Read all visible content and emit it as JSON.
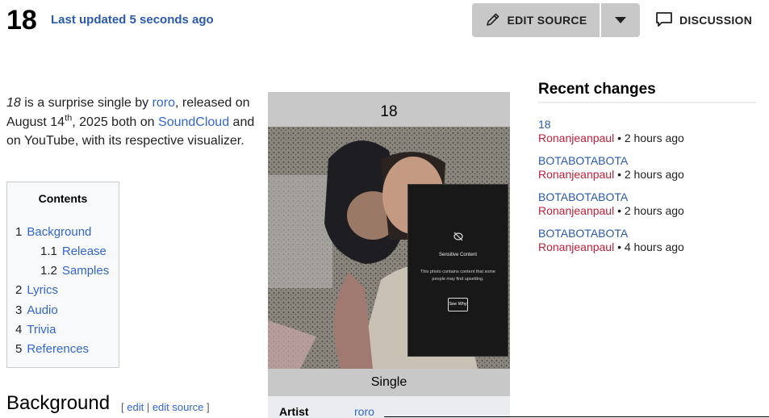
{
  "header": {
    "title": "18",
    "last_updated": "Last updated 5 seconds ago",
    "edit_source_label": "EDIT SOURCE",
    "discussion_label": "DISCUSSION"
  },
  "intro": {
    "title_italic": "18",
    "text1": " is a surprise single by ",
    "artist_link": "roro",
    "text2": ", released on August 14",
    "sup": "th",
    "text3": ", 2025 both on ",
    "soundcloud_link": "SoundCloud",
    "text4": " and on YouTube, with its respective visualizer."
  },
  "toc": {
    "title": "Contents",
    "items": [
      {
        "num": "1",
        "label": "Background"
      },
      {
        "num": "1.1",
        "label": "Release"
      },
      {
        "num": "1.2",
        "label": "Samples"
      },
      {
        "num": "2",
        "label": "Lyrics"
      },
      {
        "num": "3",
        "label": "Audio"
      },
      {
        "num": "4",
        "label": "Trivia"
      },
      {
        "num": "5",
        "label": "References"
      }
    ]
  },
  "section": {
    "heading": "Background",
    "bracket_open": "[ ",
    "edit_label": "edit",
    "sep": " | ",
    "edit_source_label": "edit source",
    "bracket_close": " ]"
  },
  "infobox": {
    "title": "18",
    "caption": "Single",
    "row_label": "Artist",
    "row_value": "roro",
    "sensitive_title": "Sensitive Content",
    "sensitive_desc": "This photo contains content that some people may find upsetting.",
    "sensitive_button": "See Why"
  },
  "recent_changes": {
    "heading": "Recent changes",
    "items": [
      {
        "page": "18",
        "user": "Ronanjeanpaul",
        "time": " • 2 hours ago"
      },
      {
        "page": "BOTABOTABOTA",
        "user": "Ronanjeanpaul",
        "time": " • 2 hours ago"
      },
      {
        "page": "BOTABOTABOTA",
        "user": "Ronanjeanpaul",
        "time": " • 2 hours ago"
      },
      {
        "page": "BOTABOTABOTA",
        "user": "Ronanjeanpaul",
        "time": " • 4 hours ago"
      }
    ]
  },
  "icons": {
    "edit": "pencil-icon",
    "dropdown": "chevron-down-icon",
    "discussion": "speech-bubble-icon",
    "sensitive": "eye-slash-icon"
  }
}
